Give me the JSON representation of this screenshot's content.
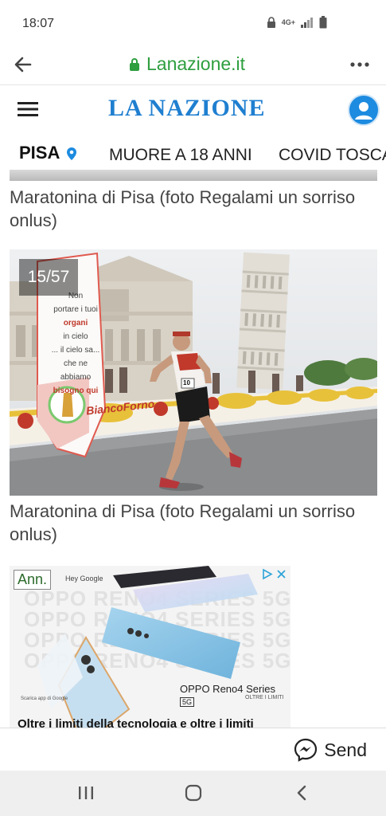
{
  "status": {
    "time": "18:07",
    "network": "4G+"
  },
  "browser": {
    "url": "Lanazione.it"
  },
  "site": {
    "logo": "LA NAZIONE"
  },
  "nav": {
    "city": "PISA",
    "tabs": [
      "MUORE A 18 ANNI",
      "COVID TOSCA"
    ]
  },
  "gallery": {
    "caption_top": "Maratonina di Pisa (foto Regalami un sorriso onlus)",
    "counter": "15/57",
    "caption_bottom": "Maratonina di Pisa (foto Regalami un sorriso onlus)",
    "banner_text": [
      "Non",
      "portare i tuoi",
      "organi",
      "in cielo",
      "... il cielo sa...",
      "che ne abbiamo",
      "bisogno qui"
    ],
    "sponsor": "BiancoForno",
    "bib": "10"
  },
  "ad": {
    "label": "Ann.",
    "voice": "Hey Google",
    "watermark": [
      "OPPO RENO4 SERIES 5G",
      "OPPO RENO4 SERIES 5G",
      "OPPO RENO4 SERIES 5G",
      "OPPO RENO4 SERIES 5G"
    ],
    "model": "OPPO Reno4 Series",
    "badge": "5G",
    "tagline": "OLTRE I LIMITI",
    "google_app": "Scarica app di Google",
    "headline": "Oltre i limiti della tecnologia e oltre i limiti"
  },
  "sendbar": {
    "label": "Send"
  },
  "colors": {
    "url_green": "#2e9e3f",
    "logo_blue": "#1f7fd0",
    "pin_blue": "#1d8be0"
  }
}
